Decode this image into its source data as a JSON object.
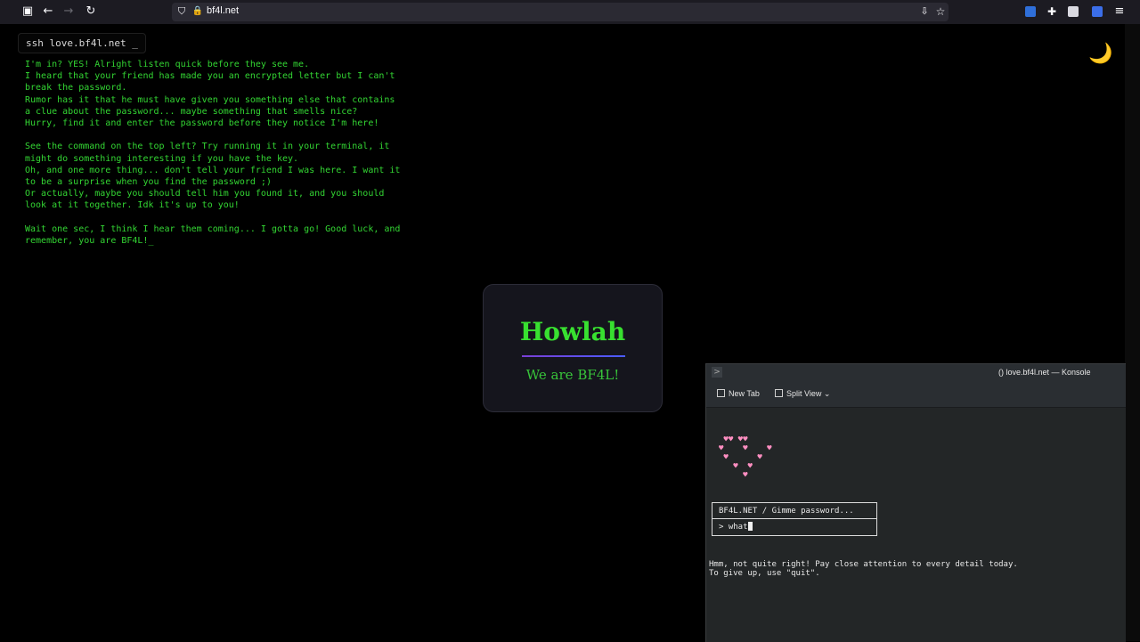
{
  "browser": {
    "url": "bf4l.net"
  },
  "page": {
    "command": "ssh love.bf4l.net _",
    "message": "I'm in? YES! Alright listen quick before they see me.\nI heard that your friend has made you an encrypted letter but I can't\nbreak the password.\nRumor has it that he must have given you something else that contains\na clue about the password... maybe something that smells nice?\nHurry, find it and enter the password before they notice I'm here!\n\nSee the command on the top left? Try running it in your terminal, it\nmight do something interesting if you have the key.\nOh, and one more thing... don't tell your friend I was here. I want it\nto be a surprise when you find the password ;)\nOr actually, maybe you should tell him you found it, and you should\nlook at it together. Idk it's up to you!\n\nWait one sec, I think I hear them coming... I gotta go! Good luck, and\nremember, you are BF4L!_",
    "moon_glyph": "🌙",
    "card": {
      "title": "Howlah",
      "subtitle": "We are BF4L!"
    }
  },
  "konsole": {
    "title": "() love.bf4l.net — Konsole",
    "new_tab_label": "New Tab",
    "split_view_label": "Split View",
    "heart_art": " ♥♥ ♥♥\n♥    ♥    ♥\n ♥      ♥\n   ♥  ♥\n     ♥",
    "prompt_header": "BF4L.NET / Gimme password...",
    "input_value": "> what",
    "response": "Hmm, not quite right! Pay close attention to every detail today.\nTo give up, use \"quit\"."
  },
  "colors": {
    "terminal_green": "#33d633",
    "title_green": "#38e030",
    "heart_pink": "#ff8fc2"
  }
}
